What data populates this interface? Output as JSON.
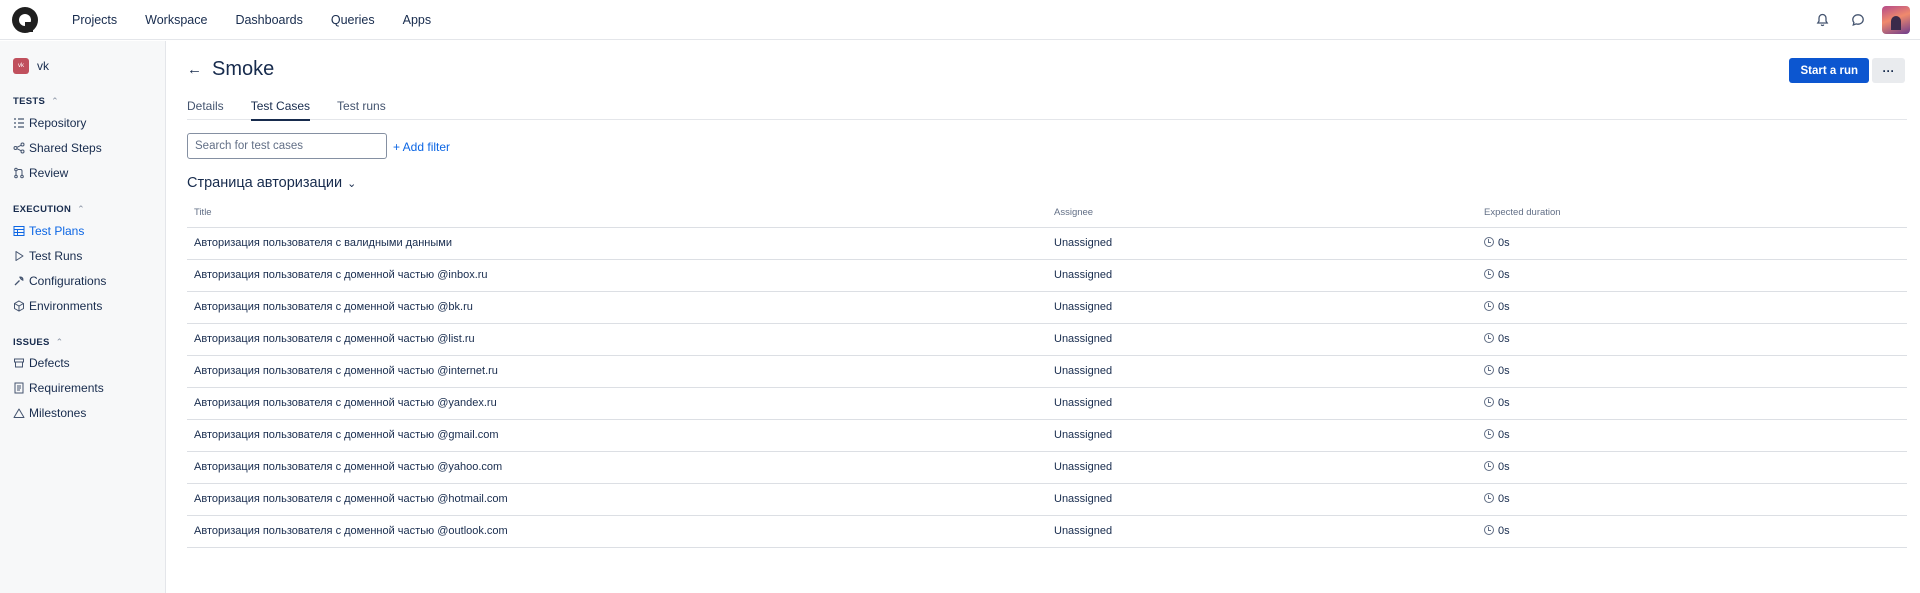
{
  "topnav": {
    "items": [
      "Projects",
      "Workspace",
      "Dashboards",
      "Queries",
      "Apps"
    ]
  },
  "sidebar": {
    "project_badge": "vk",
    "project_name": "vk",
    "sections": {
      "tests": "TESTS",
      "execution": "EXECUTION",
      "issues": "ISSUES"
    },
    "items": {
      "repository": "Repository",
      "shared_steps": "Shared Steps",
      "review": "Review",
      "test_plans": "Test Plans",
      "test_runs": "Test Runs",
      "configurations": "Configurations",
      "environments": "Environments",
      "defects": "Defects",
      "requirements": "Requirements",
      "milestones": "Milestones"
    },
    "active_item": "Test Plans"
  },
  "main": {
    "title": "Smoke",
    "start_run_label": "Start a run",
    "more_label": "···",
    "tabs": [
      "Details",
      "Test Cases",
      "Test runs"
    ],
    "active_tab": "Test Cases",
    "search_placeholder": "Search for test cases",
    "add_filter_label": "+ Add filter",
    "group_title": "Страница авторизации",
    "columns": [
      "Title",
      "Assignee",
      "Expected duration"
    ],
    "rows": [
      {
        "title": "Авторизация пользователя с валидными данными",
        "assignee": "Unassigned",
        "duration": "0s"
      },
      {
        "title": "Авторизация пользователя с доменной частью @inbox.ru",
        "assignee": "Unassigned",
        "duration": "0s"
      },
      {
        "title": "Авторизация пользователя с доменной частью @bk.ru",
        "assignee": "Unassigned",
        "duration": "0s"
      },
      {
        "title": "Авторизация пользователя с доменной частью @list.ru",
        "assignee": "Unassigned",
        "duration": "0s"
      },
      {
        "title": "Авторизация пользователя с доменной частью @internet.ru",
        "assignee": "Unassigned",
        "duration": "0s"
      },
      {
        "title": "Авторизация пользователя с доменной частью @yandex.ru",
        "assignee": "Unassigned",
        "duration": "0s"
      },
      {
        "title": "Авторизация пользователя с доменной частью @gmail.com",
        "assignee": "Unassigned",
        "duration": "0s"
      },
      {
        "title": "Авторизация пользователя с доменной частью @yahoo.com",
        "assignee": "Unassigned",
        "duration": "0s"
      },
      {
        "title": "Авторизация пользователя с доменной частью @hotmail.com",
        "assignee": "Unassigned",
        "duration": "0s"
      },
      {
        "title": "Авторизация пользователя с доменной частью @outlook.com",
        "assignee": "Unassigned",
        "duration": "0s"
      }
    ]
  },
  "colors": {
    "primary": "#0c56d0",
    "active_link": "#0c66e4",
    "sidebar_bg": "#f7f8f9"
  }
}
